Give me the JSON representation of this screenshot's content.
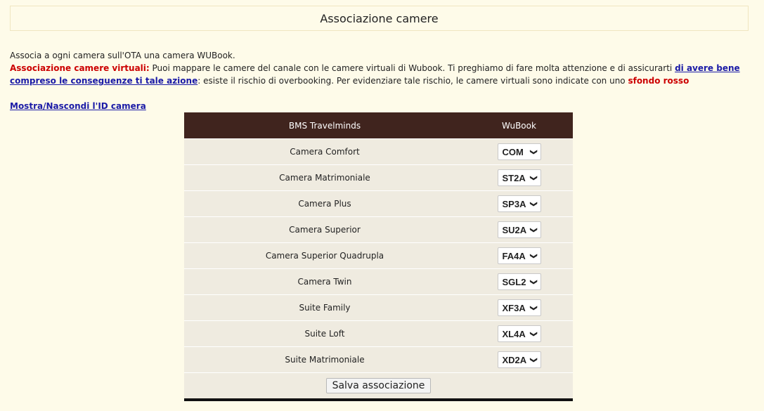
{
  "header": {
    "title": "Associazione camere"
  },
  "description": {
    "intro": "Associa a ogni camera sull'OTA una camera WUBook.",
    "virtual_label": "Associazione camere virtuali:",
    "virtual_text1": " Puoi mappare le camere del canale con le camere virtuali di Wubook. Ti preghiamo di fare molta attenzione e di assicurarti ",
    "virtual_link": "di avere bene compreso le conseguenze ti tale azione",
    "virtual_text2": ": esiste il rischio di overbooking. Per evidenziare tale rischio, le camere virtuali sono indicate con uno ",
    "red_bg": "sfondo rosso"
  },
  "toggle_link": "Mostra/Nascondi l'ID camera",
  "table": {
    "col1": "BMS Travelminds",
    "col2": "WuBook",
    "rows": [
      {
        "room": "Camera Comfort",
        "code": "COM"
      },
      {
        "room": "Camera Matrimoniale",
        "code": "ST2A"
      },
      {
        "room": "Camera Plus",
        "code": "SP3A"
      },
      {
        "room": "Camera Superior",
        "code": "SU2A"
      },
      {
        "room": "Camera Superior Quadrupla",
        "code": "FA4A"
      },
      {
        "room": "Camera Twin",
        "code": "SGL2"
      },
      {
        "room": "Suite Family",
        "code": "XF3A"
      },
      {
        "room": "Suite Loft",
        "code": "XL4A"
      },
      {
        "room": "Suite Matrimoniale",
        "code": "XD2A"
      }
    ],
    "save_button": "Salva associazione"
  },
  "icons": {
    "dropdown": "chevron-down-icon"
  },
  "colors": {
    "header_bg": "#40241e",
    "row_bg": "#efebe0",
    "page_bg": "#fefbe9",
    "warning": "#cc0000",
    "link": "#1a1aa6"
  }
}
